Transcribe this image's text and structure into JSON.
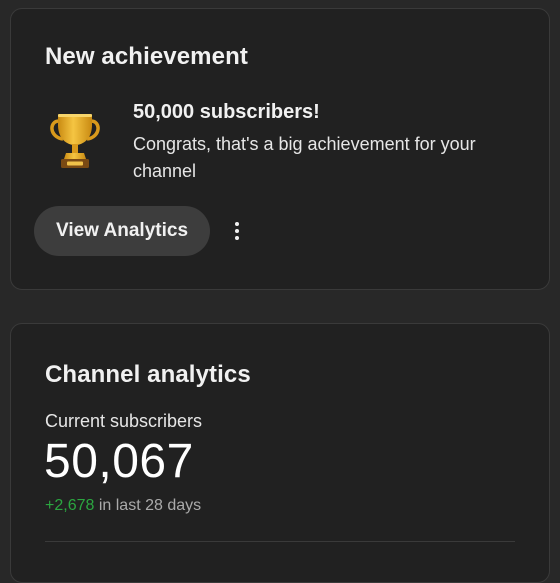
{
  "achievement_card": {
    "title": "New achievement",
    "icon": "trophy-icon",
    "heading": "50,000 subscribers!",
    "message": "Congrats, that's a big achievement for your channel",
    "primary_button": "View Analytics",
    "more_icon": "more-vert-icon"
  },
  "analytics_card": {
    "title": "Channel analytics",
    "subscribers_label": "Current subscribers",
    "subscribers_count": "50,067",
    "change_value": "+2,678",
    "change_period": "in last 28 days"
  },
  "colors": {
    "background": "#282828",
    "card": "#212121",
    "button": "#3d3d3d",
    "positive": "#2ba640",
    "trophy_gold": "#e0a526"
  }
}
